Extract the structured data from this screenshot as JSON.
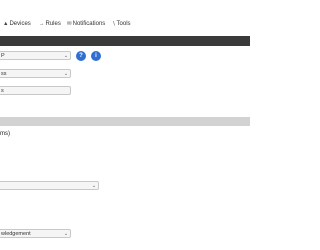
{
  "nav": {
    "devices_label": "Devices",
    "rules_label": "Rules",
    "notifications_label": "Notifications",
    "tools_label": "Tools",
    "devices_icon": "devices-icon",
    "rules_icon": "rules-icon",
    "notifications_icon": "notifications-icon",
    "tools_icon": "wrench-icon"
  },
  "form": {
    "select_1_value": "P",
    "select_2_value": "ss",
    "text_1_value": "s",
    "help_label": "?",
    "info_label": "i",
    "section_text": "ms)",
    "select_3_value": "",
    "select_4_value": "wledgement"
  },
  "colors": {
    "dark_bar": "#3a3a3a",
    "section_bar": "#d2d2d2",
    "accent_blue": "#2f6fd1"
  }
}
